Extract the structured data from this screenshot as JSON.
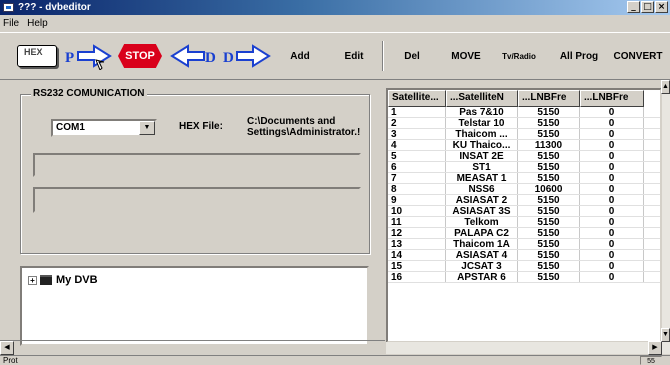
{
  "window": {
    "title": "??? - dvbeditor",
    "minimize": "_",
    "maximize": "□",
    "close": "×"
  },
  "menu": [
    {
      "label": "File"
    },
    {
      "label": "Help"
    }
  ],
  "toolbar": {
    "hex_label": "HEX",
    "stop_label": "STOP",
    "add_label": "Add",
    "edit_label": "Edit",
    "del_label": "Del",
    "move_label": "MOVE",
    "tvradio_label": "Tv/Radio",
    "allprog_label": "All Prog",
    "convert_label": "CONVERT"
  },
  "comm": {
    "group_title": "RS232 COMUNICATION",
    "port_value": "COM1",
    "hex_file_label": "HEX File:",
    "hex_file_path": "C:\\Documents and Settings\\Administrator.!"
  },
  "tree": {
    "root_label": "My DVB",
    "expander": "+"
  },
  "table": {
    "headers": [
      "Satellite...",
      "...SatelliteN",
      "...LNBFre",
      "...LNBFre"
    ],
    "rows": [
      [
        "1",
        "Pas 7&10",
        "5150",
        "0"
      ],
      [
        "2",
        "Telstar 10",
        "5150",
        "0"
      ],
      [
        "3",
        "Thaicom ...",
        "5150",
        "0"
      ],
      [
        "4",
        "KU Thaico...",
        "11300",
        "0"
      ],
      [
        "5",
        "INSAT 2E",
        "5150",
        "0"
      ],
      [
        "6",
        "ST1",
        "5150",
        "0"
      ],
      [
        "7",
        "MEASAT 1",
        "5150",
        "0"
      ],
      [
        "8",
        "NSS6",
        "10600",
        "0"
      ],
      [
        "9",
        "ASIASAT 2",
        "5150",
        "0"
      ],
      [
        "10",
        "ASIASAT 3S",
        "5150",
        "0"
      ],
      [
        "11",
        "Telkom",
        "5150",
        "0"
      ],
      [
        "12",
        "PALAPA C2",
        "5150",
        "0"
      ],
      [
        "13",
        "Thaicom 1A",
        "5150",
        "0"
      ],
      [
        "14",
        "ASIASAT 4",
        "5150",
        "0"
      ],
      [
        "15",
        "JCSAT 3",
        "5150",
        "0"
      ],
      [
        "16",
        "APSTAR 6",
        "5150",
        "0"
      ]
    ]
  },
  "status": {
    "text": "Prot",
    "panel": "55"
  },
  "colors": {
    "title_start": "#0a246a",
    "title_end": "#a6caf0",
    "stop_red": "#d9001b",
    "arrow_blue": "#1a40d0"
  }
}
